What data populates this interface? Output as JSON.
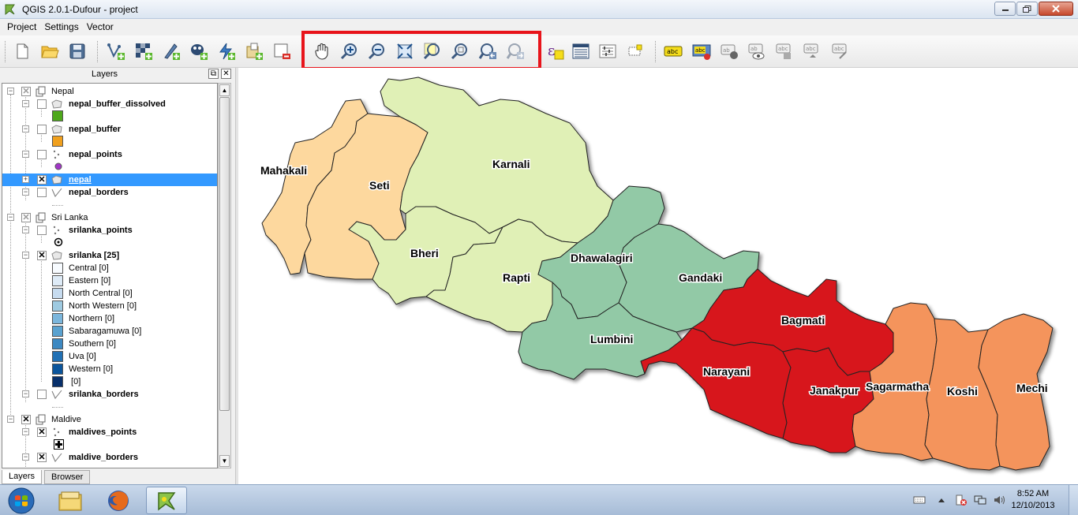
{
  "window": {
    "title": "QGIS 2.0.1-Dufour - project",
    "min_icon": "minimize-icon",
    "max_icon": "maximize-icon",
    "close_icon": "close-icon"
  },
  "menubar": [
    "Project",
    "Settings",
    "Vector"
  ],
  "toolbar": {
    "file_tools": [
      "new-project-icon",
      "open-project-icon",
      "save-project-icon"
    ],
    "layer_tools": [
      "add-vector-layer-icon",
      "add-raster-layer-icon",
      "add-delimited-text-icon",
      "add-postgis-icon",
      "add-spatialite-icon",
      "add-wms-icon",
      "remove-layer-icon"
    ],
    "nav_tools": [
      "pan-icon",
      "zoom-in-icon",
      "zoom-out-icon",
      "zoom-full-icon",
      "zoom-to-selection-icon",
      "zoom-to-layer-icon",
      "zoom-last-icon",
      "zoom-next-icon"
    ],
    "attribute_tools": [
      "field-calculator-icon",
      "attribute-table-icon",
      "measure-icon",
      "new-annotation-icon"
    ],
    "label_tools": [
      "label-icon",
      "label-highlight-icon",
      "pin-label-icon",
      "show-hide-label-icon",
      "move-label-icon",
      "rotate-label-icon",
      "change-label-icon"
    ],
    "highlight_color": "#e8141b"
  },
  "layers_panel": {
    "title": "Layers",
    "rows": [
      {
        "type": "group",
        "label": "Nepal",
        "checked": "partial",
        "expanded": true
      },
      {
        "type": "layer",
        "label": "nepal_buffer_dissolved",
        "checked": false,
        "geom": "polygon"
      },
      {
        "type": "layer",
        "label": "nepal_buffer",
        "checked": false,
        "geom": "polygon"
      },
      {
        "type": "layer",
        "label": "nepal_points",
        "checked": false,
        "geom": "point"
      },
      {
        "type": "layer",
        "label": "nepal",
        "checked": true,
        "geom": "polygon",
        "selected": true
      },
      {
        "type": "layer",
        "label": "nepal_borders",
        "checked": false,
        "geom": "line"
      },
      {
        "type": "group",
        "label": "Sri Lanka",
        "checked": "partial",
        "expanded": true
      },
      {
        "type": "layer",
        "label": "srilanka_points",
        "checked": false,
        "geom": "point"
      },
      {
        "type": "layer",
        "label": "srilanka [25]",
        "checked": true,
        "geom": "polygon"
      },
      {
        "type": "layer",
        "label": "srilanka_borders",
        "checked": false,
        "geom": "line"
      },
      {
        "type": "group",
        "label": "Maldive",
        "checked": true,
        "expanded": true
      },
      {
        "type": "layer",
        "label": "maldives_points",
        "checked": true,
        "geom": "point"
      },
      {
        "type": "layer",
        "label": "maldive_borders",
        "checked": true,
        "geom": "line"
      }
    ],
    "legend": {
      "nepal_buffer_dissolved": "#4ea81c",
      "nepal_buffer": "#f0a01e",
      "nepal_points": "#a235c8"
    },
    "srilanka_classes": [
      {
        "label": "Central [0]",
        "color": "#f7fbff"
      },
      {
        "label": "Eastern [0]",
        "color": "#deebf7"
      },
      {
        "label": "North Central [0]",
        "color": "#c6dbef"
      },
      {
        "label": "North Western [0]",
        "color": "#9ecae1"
      },
      {
        "label": "Northern [0]",
        "color": "#7bb6dc"
      },
      {
        "label": "Sabaragamuwa [0]",
        "color": "#5aa2d0"
      },
      {
        "label": "Southern [0]",
        "color": "#3d89c2"
      },
      {
        "label": "Uva [0]",
        "color": "#2070b4"
      },
      {
        "label": "Western [0]",
        "color": "#0b559c"
      },
      {
        "label": " [0]",
        "color": "#08306b"
      }
    ],
    "tabs": [
      "Layers",
      "Browser"
    ]
  },
  "map": {
    "regions": [
      {
        "name": "Mahakali",
        "color": "#fdd89e"
      },
      {
        "name": "Seti",
        "color": "#fdd89e"
      },
      {
        "name": "Karnali",
        "color": "#e0f0b6"
      },
      {
        "name": "Bheri",
        "color": "#e0f0b6"
      },
      {
        "name": "Rapti",
        "color": "#e0f0b6"
      },
      {
        "name": "Dhawalagiri",
        "color": "#92c9a6"
      },
      {
        "name": "Gandaki",
        "color": "#92c9a6"
      },
      {
        "name": "Lumbini",
        "color": "#92c9a6"
      },
      {
        "name": "Bagmati",
        "color": "#d7191c"
      },
      {
        "name": "Narayani",
        "color": "#d7191c"
      },
      {
        "name": "Janakpur",
        "color": "#d7191c"
      },
      {
        "name": "Sagarmatha",
        "color": "#f4945b"
      },
      {
        "name": "Koshi",
        "color": "#f4945b"
      },
      {
        "name": "Mechi",
        "color": "#f4945b"
      }
    ]
  },
  "taskbar": {
    "items": [
      "start-orb-icon",
      "explorer-icon",
      "firefox-icon",
      "qgis-icon"
    ],
    "time": "8:52 AM",
    "date": "12/10/2013"
  }
}
